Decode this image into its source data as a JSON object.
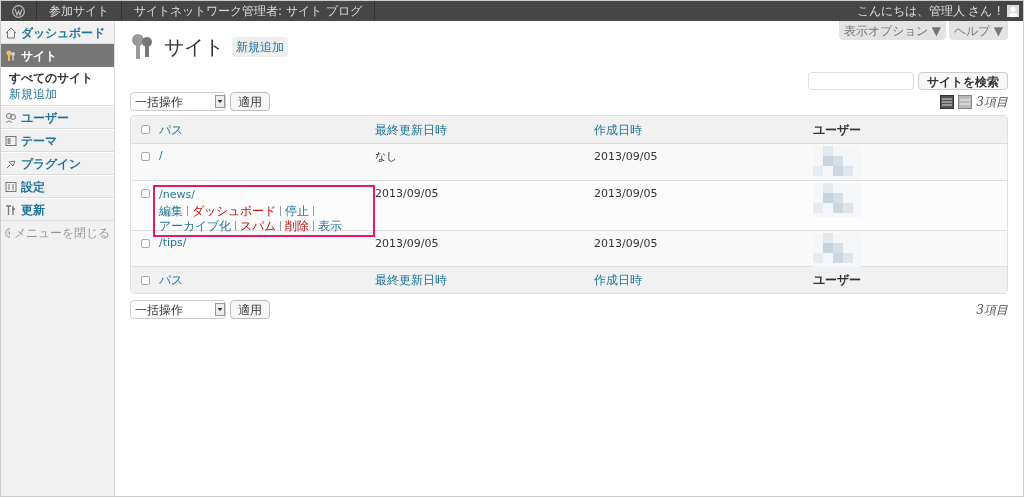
{
  "admin_bar": {
    "left": [
      "参加サイト",
      "サイトネットワーク管理者: サイト ブログ"
    ],
    "greeting": "こんにちは、管理人 さん !"
  },
  "sidebar": {
    "items": [
      {
        "label": "ダッシュボード",
        "kind": "dashboard",
        "selected": false
      },
      {
        "label": "サイト",
        "kind": "sites",
        "selected": true,
        "children": [
          {
            "label": "すべてのサイト",
            "selected": true
          },
          {
            "label": "新規追加",
            "selected": false
          }
        ]
      },
      {
        "label": "ユーザー",
        "kind": "users",
        "selected": false
      },
      {
        "label": "テーマ",
        "kind": "themes",
        "selected": false
      },
      {
        "label": "プラグイン",
        "kind": "plugins",
        "selected": false
      },
      {
        "label": "設定",
        "kind": "settings",
        "selected": false
      },
      {
        "label": "更新",
        "kind": "updates",
        "selected": false
      }
    ],
    "collapse": "メニューを閉じる"
  },
  "screen_tabs": [
    "表示オプション ▼",
    "ヘルプ ▼"
  ],
  "title": "サイト",
  "add_new": "新規追加",
  "search": {
    "button": "サイトを検索"
  },
  "bulk_top": {
    "select": "一括操作",
    "apply": "適用"
  },
  "bulk_bottom": {
    "select": "一括操作",
    "apply": "適用"
  },
  "count_top": "3項目",
  "count_bottom": "3項目",
  "table": {
    "columns": [
      "パス",
      "最終更新日時",
      "作成日時",
      "ユーザー"
    ],
    "select_all_checked": false,
    "footer_columns": [
      "パス",
      "最終更新日時",
      "作成日時",
      "ユーザー"
    ],
    "footer_select_all_checked": false,
    "rows": [
      {
        "path": "/",
        "updated": "なし",
        "created": "2013/09/05",
        "checked": false,
        "highlighted": false
      },
      {
        "path": "/news/",
        "updated": "2013/09/05",
        "created": "2013/09/05",
        "checked": false,
        "highlighted": true,
        "actions": [
          {
            "label": "編集",
            "kind": "normal"
          },
          {
            "label": "ダッシュボード",
            "kind": "danger"
          },
          {
            "label": "停止",
            "kind": "normal"
          },
          {
            "label": "アーカイブ化",
            "kind": "normal"
          },
          {
            "label": "スパム",
            "kind": "danger"
          },
          {
            "label": "削除",
            "kind": "danger"
          },
          {
            "label": "表示",
            "kind": "normal"
          }
        ]
      },
      {
        "path": "/tips/",
        "updated": "2013/09/05",
        "created": "2013/09/05",
        "checked": false,
        "highlighted": false
      }
    ]
  }
}
